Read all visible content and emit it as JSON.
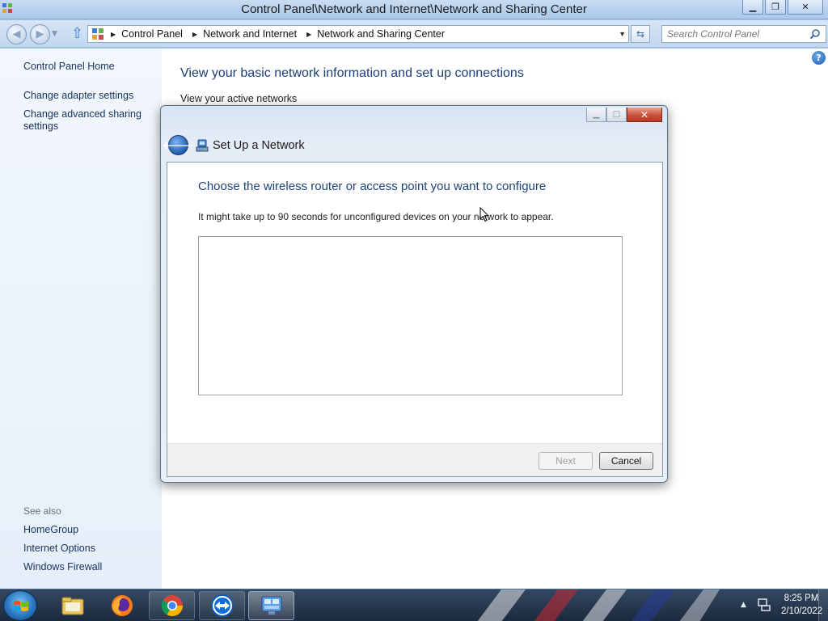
{
  "window": {
    "title": "Control Panel\\Network and Internet\\Network and Sharing Center"
  },
  "address_bar": {
    "crumbs": [
      "Control Panel",
      "Network and Internet",
      "Network and Sharing Center"
    ],
    "search_placeholder": "Search Control Panel"
  },
  "left_pane": {
    "home": "Control Panel Home",
    "links": [
      "Change adapter settings",
      "Change advanced sharing settings"
    ],
    "see_also_label": "See also",
    "see_also": [
      "HomeGroup",
      "Internet Options",
      "Windows Firewall"
    ]
  },
  "content": {
    "heading": "View your basic network information and set up connections",
    "subheading": "View your active networks",
    "help": "?"
  },
  "dialog": {
    "title": "Set Up a Network",
    "heading": "Choose the wireless router or access point you want to configure",
    "text": "It might take up to 90 seconds for unconfigured devices on your network to appear.",
    "devices": [],
    "next_label": "Next",
    "cancel_label": "Cancel"
  },
  "taskbar": {
    "apps": [
      "file-explorer",
      "firefox",
      "chrome",
      "teamviewer",
      "network-and-sharing-center"
    ],
    "time": "8:25 PM",
    "date": "2/10/2022"
  },
  "colors": {
    "heading_blue": "#1c3e78",
    "link_blue": "#15315d",
    "close_red": "#c9503a"
  }
}
